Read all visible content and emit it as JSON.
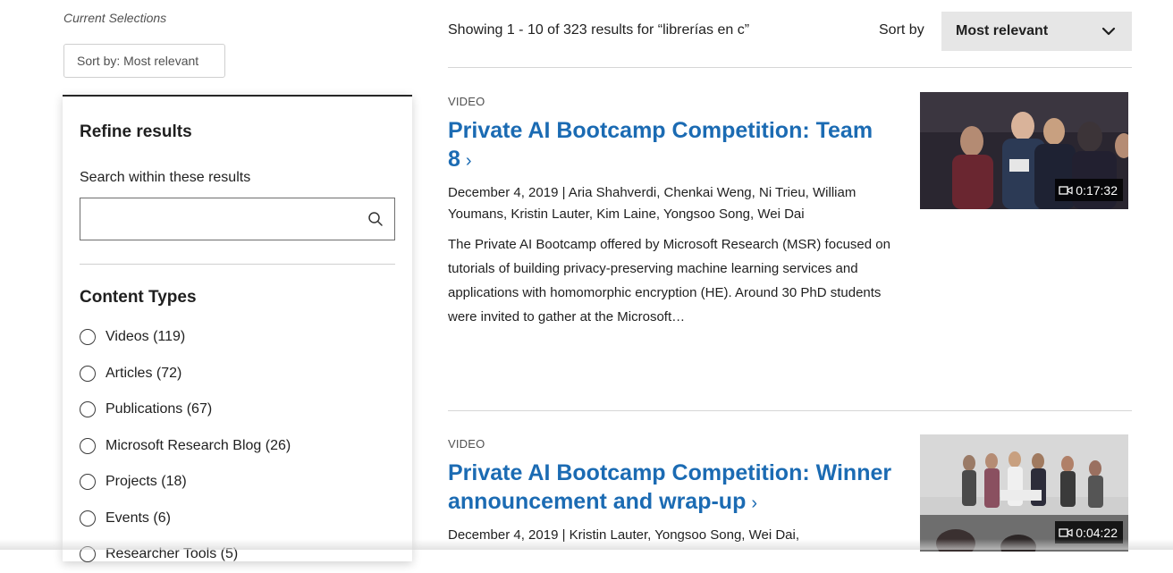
{
  "filters": {
    "current_label": "Current Selections",
    "chip_label": "Sort by: Most relevant"
  },
  "refine": {
    "title": "Refine results",
    "search_label": "Search within these results",
    "search_value": "",
    "content_types_title": "Content Types",
    "content_types": [
      {
        "label": "Videos (119)"
      },
      {
        "label": "Articles (72)"
      },
      {
        "label": "Publications (67)"
      },
      {
        "label": "Microsoft Research Blog (26)"
      },
      {
        "label": "Projects (18)"
      },
      {
        "label": "Events (6)"
      },
      {
        "label": "Researcher Tools (5)"
      }
    ]
  },
  "results_header": {
    "count_text": "Showing 1 - 10 of 323 results for “librerías en c”",
    "sort_label": "Sort by",
    "sort_value": "Most relevant"
  },
  "results": [
    {
      "type": "VIDEO",
      "title": "Private AI Bootcamp Competition: Team 8",
      "arrow": "›",
      "meta": "December 4, 2019  |  Aria Shahverdi, Chenkai Weng, Ni Trieu, William Youmans, Kristin Lauter, Kim Laine, Yongsoo Song, Wei Dai",
      "description": "The Private AI Bootcamp offered by Microsoft Research (MSR) focused on tutorials of building privacy-preserving machine learning services and applications with homomorphic encryption (HE). Around 30 PhD students were invited to gather at the Microsoft…",
      "duration": "0:17:32"
    },
    {
      "type": "VIDEO",
      "title": "Private AI Bootcamp Competition: Winner announcement and wrap-up",
      "arrow": "›",
      "meta": "December 4, 2019  |  Kristin Lauter, Yongsoo Song, Wei Dai,",
      "duration": "0:04:22"
    }
  ],
  "colors": {
    "link": "#1b6bb3",
    "sort_bg": "#e6e6e6",
    "text": "#1f1f1f"
  }
}
